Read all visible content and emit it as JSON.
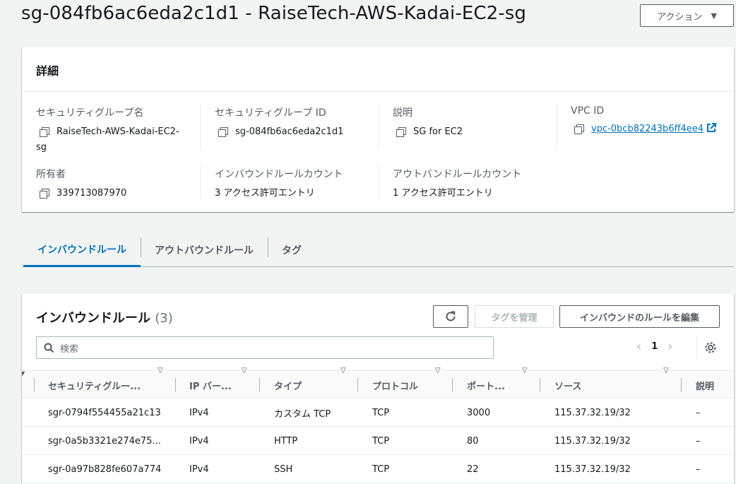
{
  "page": {
    "title": "sg-084fb6ac6eda2c1d1 - RaiseTech-AWS-Kadai-EC2-sg",
    "action_label": "アクション"
  },
  "details": {
    "header": "詳細",
    "sg_name_label": "セキュリティグループ名",
    "sg_name_line1": "RaiseTech-AWS-Kadai-EC2-",
    "sg_name_line2": "sg",
    "sg_id_label": "セキュリティグループ ID",
    "sg_id": "sg-084fb6ac6eda2c1d1",
    "desc_label": "説明",
    "desc": "SG for EC2",
    "vpc_label": "VPC ID",
    "vpc_id": "vpc-0bcb82243b6ff4ee4",
    "owner_label": "所有者",
    "owner": "339713087970",
    "inbound_count_label": "インバウンドルールカウント",
    "inbound_count": "3 アクセス許可エントリ",
    "outbound_count_label": "アウトバンドルールカウント",
    "outbound_count": "1 アクセス許可エントリ"
  },
  "tabs": [
    {
      "label": "インバウンドルール",
      "active": true
    },
    {
      "label": "アウトバウンドルール",
      "active": false
    },
    {
      "label": "タグ",
      "active": false
    }
  ],
  "rules": {
    "title": "インバウンドルール",
    "count": "(3)",
    "manage_tags_label": "タグを管理",
    "edit_label": "インバウンドのルールを編集",
    "search_placeholder": "検索",
    "page_number": "1",
    "columns": [
      "セキュリティグルー...",
      "IP バー...",
      "タイプ",
      "プロトコル",
      "ポート...",
      "ソース",
      "説明"
    ],
    "rows": [
      {
        "id": "sgr-0794f554455a21c13",
        "ip": "IPv4",
        "type": "カスタム TCP",
        "protocol": "TCP",
        "port": "3000",
        "source": "115.37.32.19/32",
        "desc": "–"
      },
      {
        "id": "sgr-0a5b3321e274e75...",
        "ip": "IPv4",
        "type": "HTTP",
        "protocol": "TCP",
        "port": "80",
        "source": "115.37.32.19/32",
        "desc": "–"
      },
      {
        "id": "sgr-0a97b828fe607a774",
        "ip": "IPv4",
        "type": "SSH",
        "protocol": "TCP",
        "port": "22",
        "source": "115.37.32.19/32",
        "desc": "–"
      }
    ]
  },
  "colors": {
    "accent": "#0073bb",
    "text": "#16191f",
    "muted": "#545b64"
  }
}
